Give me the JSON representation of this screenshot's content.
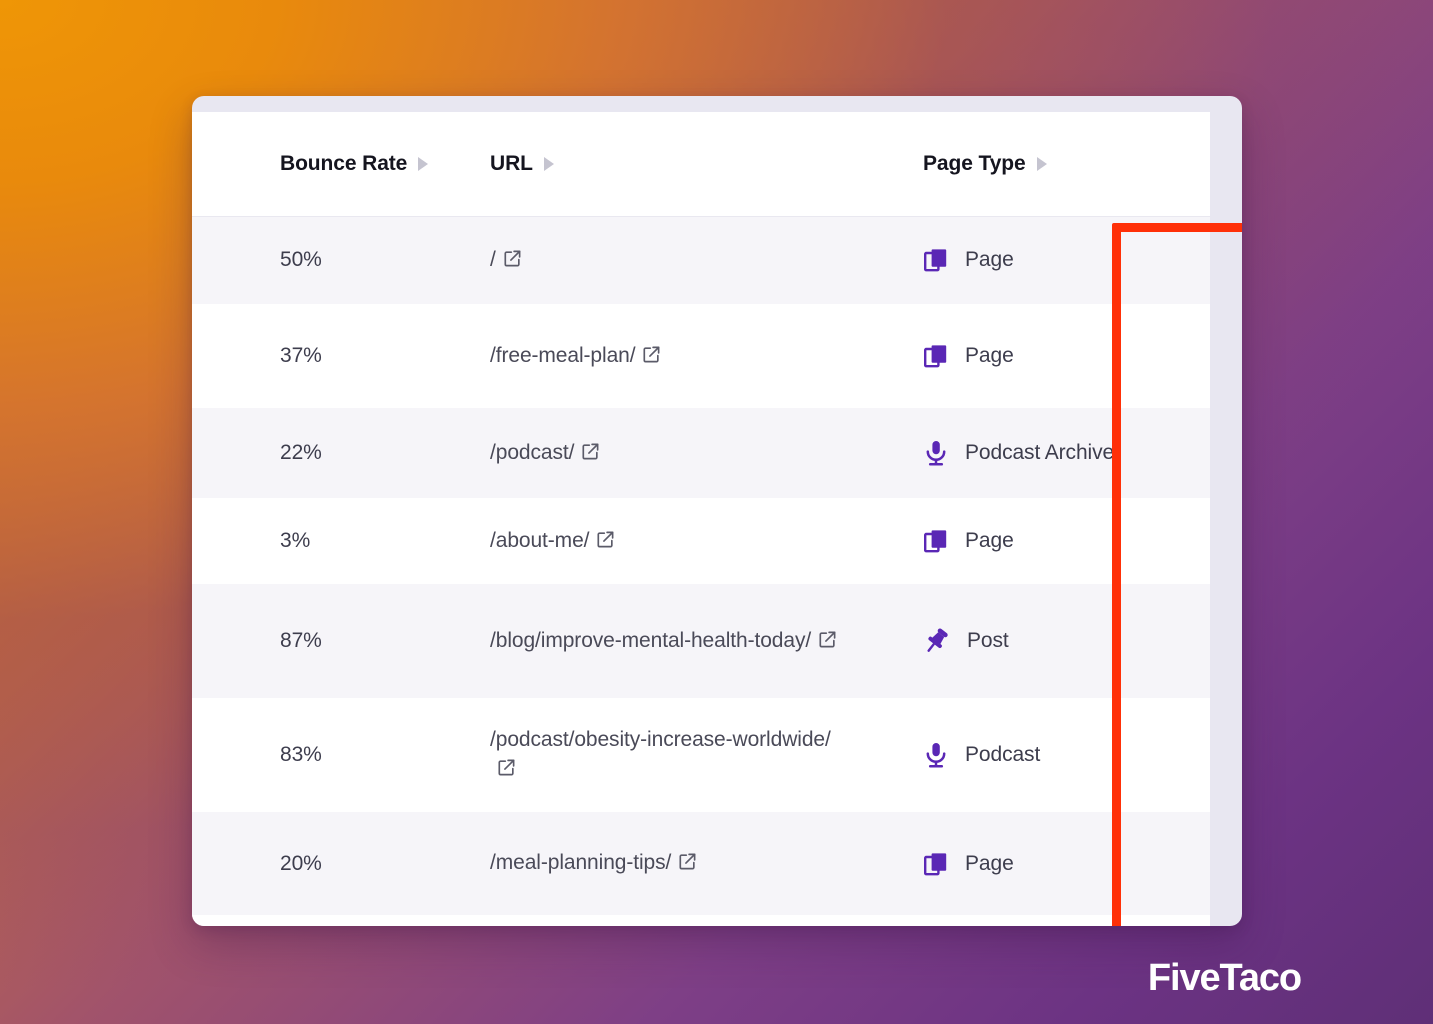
{
  "colors": {
    "accent_red": "#ff3008",
    "icon_purple": "#5a27b5",
    "row_shade": "#f6f5f9",
    "card_frame": "#e8e7f1"
  },
  "table": {
    "columns": [
      {
        "label": "Bounce Rate",
        "sort_icon": "sort-caret-icon"
      },
      {
        "label": "URL",
        "sort_icon": "sort-caret-icon"
      },
      {
        "label": "Page Type",
        "sort_icon": "sort-caret-icon"
      }
    ],
    "rows": [
      {
        "bounce_rate": "50%",
        "url": "/",
        "link_icon": "external-link-icon",
        "page_type": "Page",
        "type_icon": "pages-stack-icon"
      },
      {
        "bounce_rate": "37%",
        "url": "/free-meal-plan/",
        "link_icon": "external-link-icon",
        "page_type": "Page",
        "type_icon": "pages-stack-icon"
      },
      {
        "bounce_rate": "22%",
        "url": "/podcast/",
        "link_icon": "external-link-icon",
        "page_type": "Podcast Archive",
        "type_icon": "microphone-icon"
      },
      {
        "bounce_rate": "3%",
        "url": "/about-me/",
        "link_icon": "external-link-icon",
        "page_type": "Page",
        "type_icon": "pages-stack-icon"
      },
      {
        "bounce_rate": "87%",
        "url": "/blog/improve-mental-health-today/",
        "link_icon": "external-link-icon",
        "page_type": "Post",
        "type_icon": "pushpin-icon"
      },
      {
        "bounce_rate": "83%",
        "url": "/podcast/obesity-increase-worldwide/",
        "link_icon": "external-link-icon",
        "page_type": "Podcast",
        "type_icon": "microphone-icon"
      },
      {
        "bounce_rate": "20%",
        "url": "/meal-planning-tips/",
        "link_icon": "external-link-icon",
        "page_type": "Page",
        "type_icon": "pages-stack-icon"
      }
    ]
  },
  "watermark": {
    "text": "FiveTaco"
  }
}
